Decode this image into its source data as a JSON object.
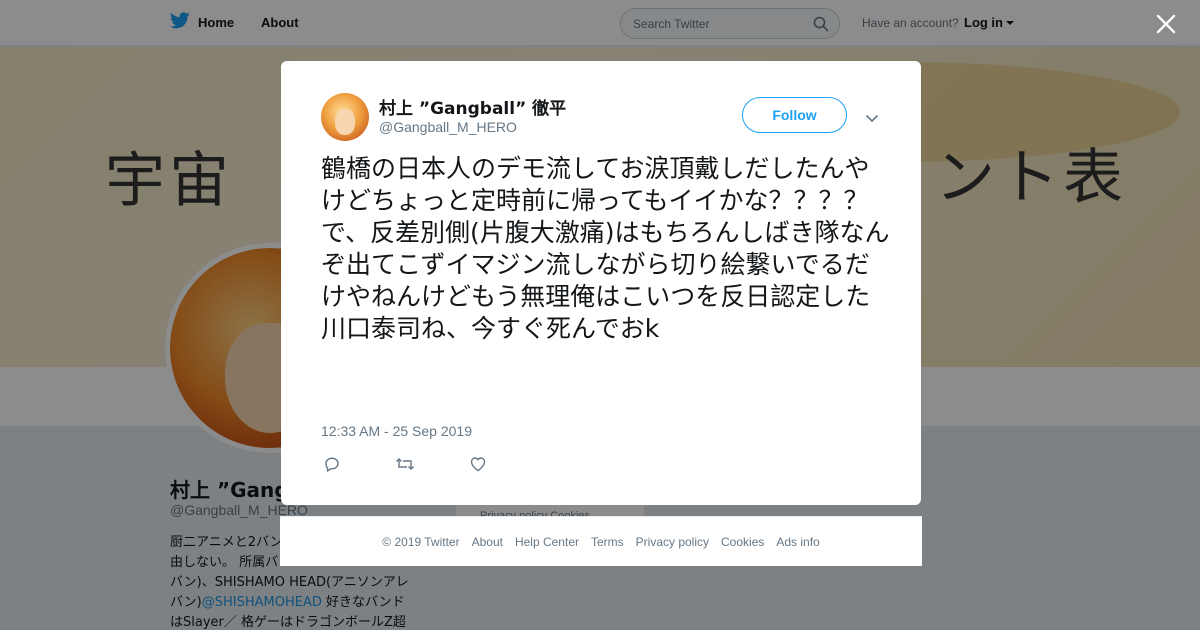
{
  "nav": {
    "home_label": "Home",
    "about_label": "About",
    "search_placeholder": "Search Twitter",
    "account_prompt": "Have an account?",
    "login_label": "Log in"
  },
  "banner": {
    "left_text": "宇宙",
    "right_text": "ント表"
  },
  "profile": {
    "name": "村上 ”Gang",
    "handle": "@Gangball_M_HERO",
    "bio_lines": [
      "厨二アニメと2バン",
      "由しない。 所属バ",
      "バン)、SHISHAMO HEAD(アニソンアレ",
      "バン)"
    ],
    "bio_link": "@SHISHAMOHEAD",
    "bio_after_link": " 好きなバンド",
    "bio_last": "はSlayer／ 格ゲーはドラゴンボールZ超"
  },
  "side": {
    "links": "Privacy policy  Cookies"
  },
  "tweet": {
    "author_name": "村上 ”Gangball” 徹平",
    "author_handle": "@Gangball_M_HERO",
    "follow_label": "Follow",
    "text": "鶴橋の日本人のデモ流してお涙頂戴しだしたんやけどちょっと定時前に帰ってもイイかな？？？？\nで、反差別側(片腹大激痛)はもちろんしばき隊なんぞ出てこずイマジン流しながら切り絵繋いでるだけやねんけどもう無理俺はこいつを反日認定した\n川口泰司ね、今すぐ死んでおk",
    "timestamp": "12:33 AM - 25 Sep 2019"
  },
  "footer": {
    "copyright": "© 2019 Twitter",
    "about": "About",
    "help": "Help Center",
    "terms": "Terms",
    "privacy": "Privacy policy",
    "cookies": "Cookies",
    "ads": "Ads info"
  },
  "icons": {
    "brand": "twitter-bird-icon",
    "search": "search-icon",
    "close": "close-icon",
    "reply": "reply-icon",
    "retweet": "retweet-icon",
    "like": "heart-icon",
    "chevron": "chevron-down-icon"
  },
  "colors": {
    "brand": "#1da1f2",
    "text": "#14171a",
    "muted": "#657786"
  }
}
